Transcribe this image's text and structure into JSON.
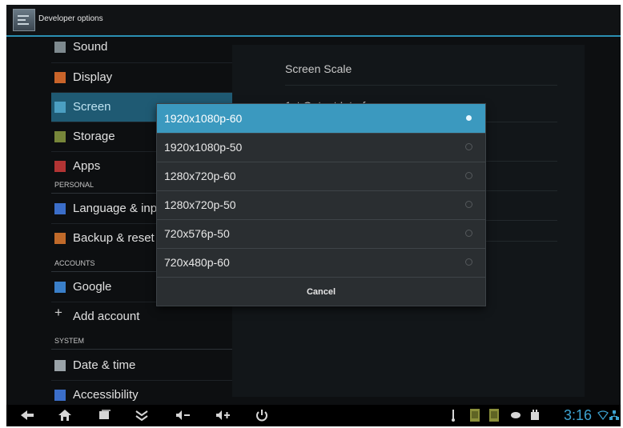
{
  "action_bar": {
    "title": "Developer options",
    "app_icon": "settings-app-icon"
  },
  "headers": {
    "items": [
      {
        "label": "Sound",
        "icon": "sound-icon",
        "color": "#7e8a8f"
      },
      {
        "label": "Display",
        "icon": "display-icon",
        "color": "#c9642a"
      },
      {
        "label": "Screen",
        "icon": "screen-icon",
        "color": "#4b9fc2",
        "selected": true
      },
      {
        "label": "Storage",
        "icon": "storage-icon",
        "color": "#77863a"
      },
      {
        "label": "Apps",
        "icon": "apps-icon",
        "color": "#b23434"
      }
    ],
    "personal_title": "PERSONAL",
    "personal_items": [
      {
        "label": "Language & input",
        "icon": "language-icon",
        "color": "#3b6ec9"
      },
      {
        "label": "Backup & reset",
        "icon": "backup-icon",
        "color": "#c06a2a"
      }
    ],
    "accounts_title": "ACCOUNTS",
    "accounts_items": [
      {
        "label": "Google",
        "icon": "google-icon",
        "color": "#3a7fc9"
      },
      {
        "label": "Add account",
        "icon": "plus-icon"
      }
    ],
    "system_title": "SYSTEM",
    "system_items": [
      {
        "label": "Date & time",
        "icon": "clock-icon",
        "color": "#9aa3a8"
      },
      {
        "label": "Accessibility",
        "icon": "accessibility-icon",
        "color": "#3b6ec9"
      }
    ]
  },
  "detail": {
    "rows": [
      "Screen Scale",
      "1st Output Interface"
    ]
  },
  "dialog": {
    "options": [
      {
        "label": "1920x1080p-60",
        "selected": true
      },
      {
        "label": "1920x1080p-50",
        "selected": false
      },
      {
        "label": "1280x720p-60",
        "selected": false
      },
      {
        "label": "1280x720p-50",
        "selected": false
      },
      {
        "label": "720x576p-50",
        "selected": false
      },
      {
        "label": "720x480p-60",
        "selected": false
      }
    ],
    "cancel_label": "Cancel"
  },
  "system_bar": {
    "nav_icons": [
      "back-icon",
      "home-icon",
      "recent-apps-icon",
      "hide-bar-icon",
      "volume-down-icon",
      "volume-up-icon",
      "power-icon"
    ],
    "status_icons": [
      "usb-icon",
      "sdcard-icon",
      "sdcard-icon",
      "chat-icon",
      "android-debug-icon"
    ],
    "time": "3:16"
  },
  "colors": {
    "accent": "#3b99bf",
    "clock": "#3da3d1"
  }
}
